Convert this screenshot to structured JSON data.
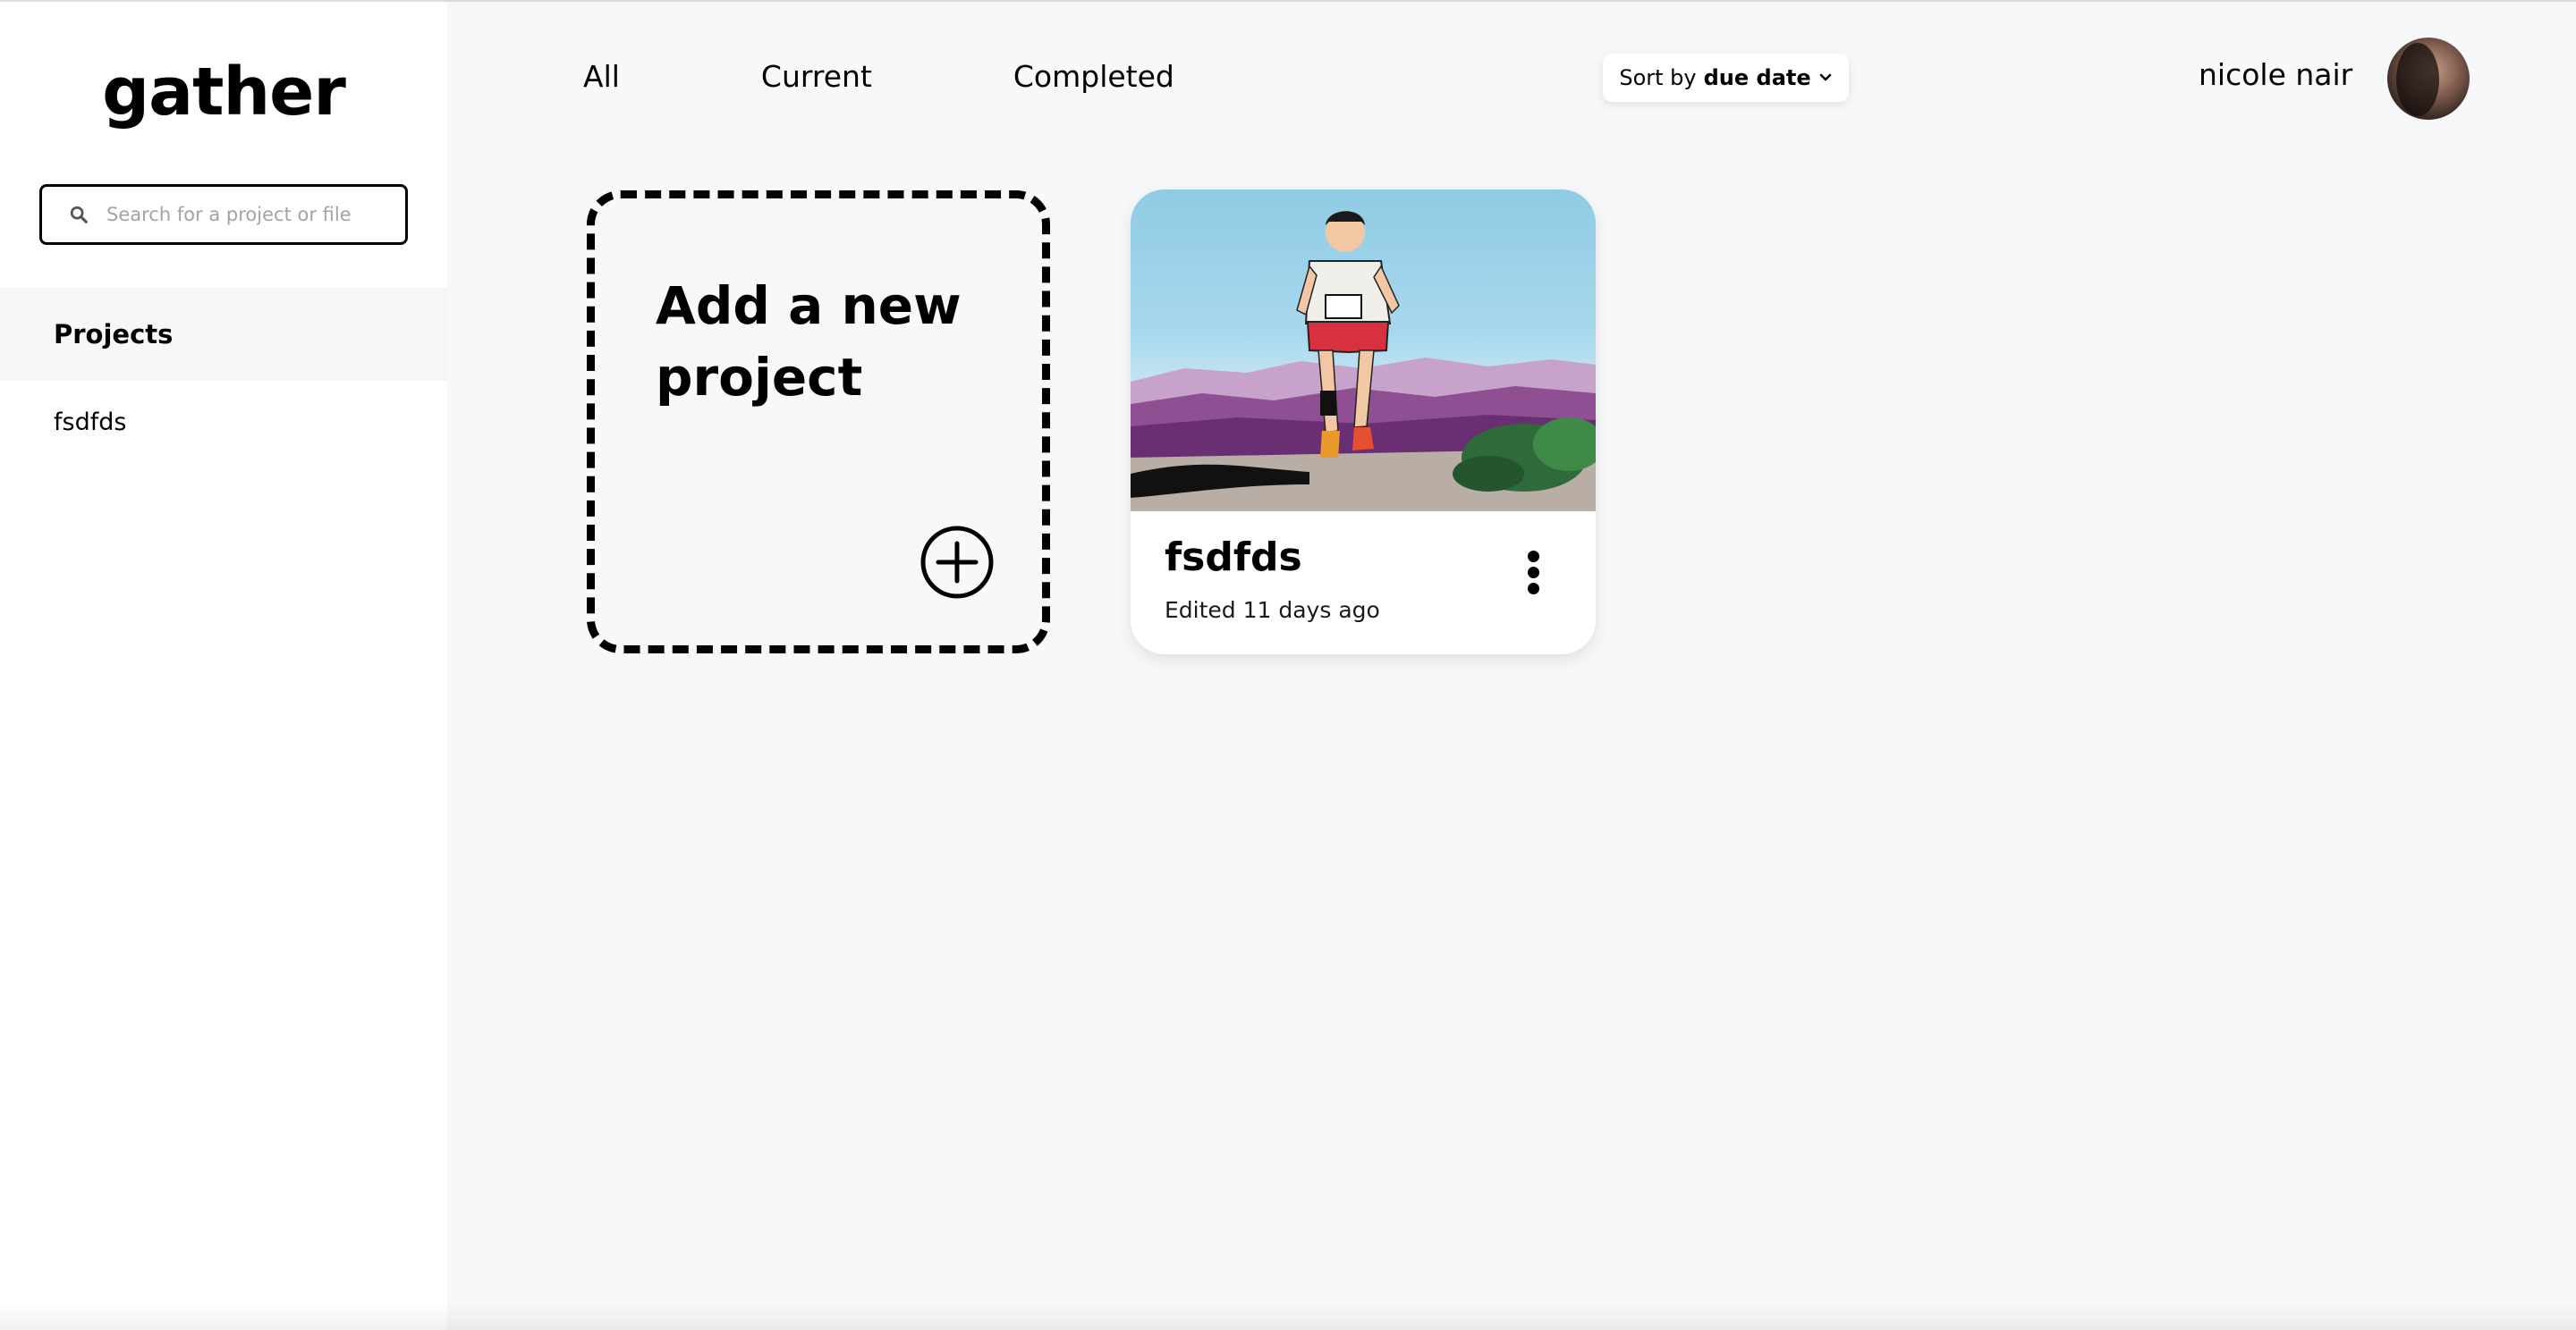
{
  "app": {
    "logo": "gather"
  },
  "sidebar": {
    "search_placeholder": "Search for a project or file",
    "heading": "Projects",
    "items": [
      {
        "label": "fsdfds"
      }
    ]
  },
  "header": {
    "tabs": [
      {
        "label": "All"
      },
      {
        "label": "Current"
      },
      {
        "label": "Completed"
      }
    ],
    "sort": {
      "prefix": "Sort by",
      "value": "due date"
    },
    "user": {
      "name": "nicole nair"
    }
  },
  "main": {
    "new_project": {
      "title": "Add a new project"
    },
    "projects": [
      {
        "name": "fsdfds",
        "edited": "Edited 11 days ago"
      }
    ]
  },
  "colors": {
    "background": "#f7f8fa",
    "sidebar": "#ffffff",
    "accent": "#000000"
  }
}
